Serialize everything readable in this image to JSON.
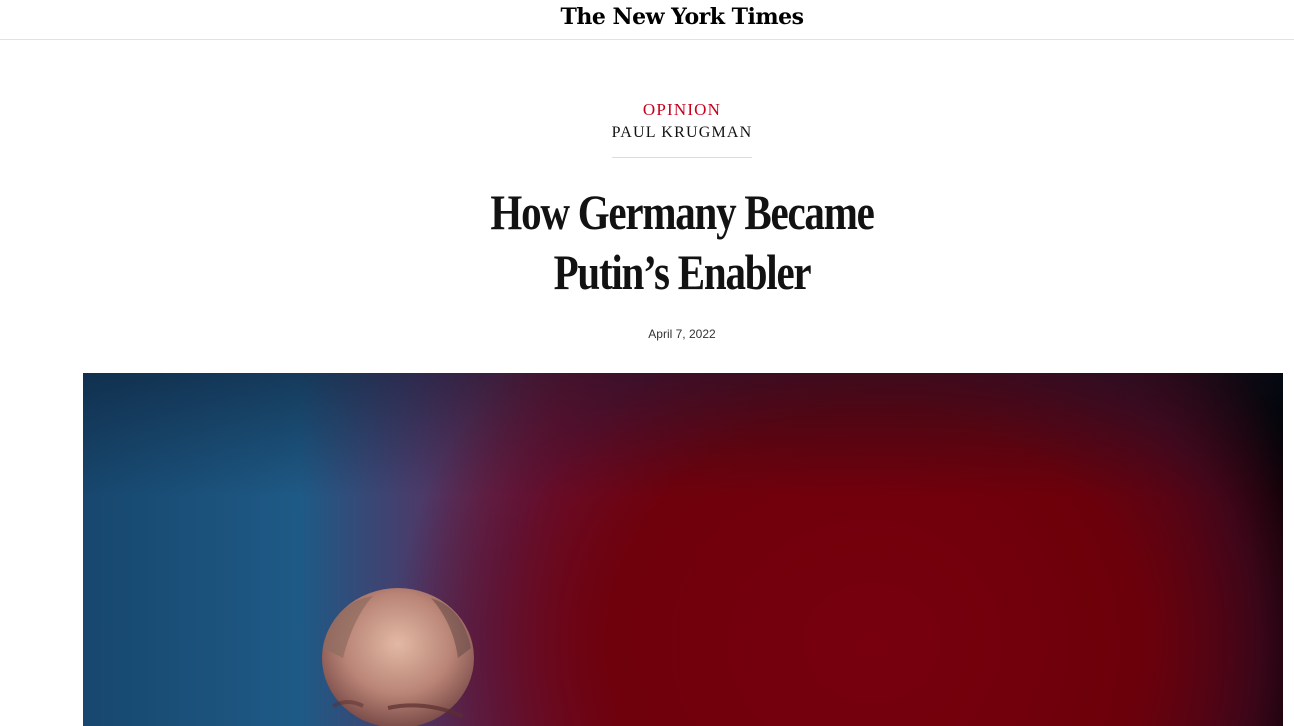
{
  "masthead": {
    "logo_text": "The New York Times"
  },
  "article": {
    "kicker": "OPINION",
    "byline": "PAUL KRUGMAN",
    "headline": "How Germany Became Putin’s Enabler",
    "date": "April 7, 2022"
  },
  "colors": {
    "kicker": "#c8001e",
    "text": "#121212",
    "rule": "#e2e2e2"
  },
  "hero_image": {
    "icon": "photo-of-man-against-red-and-blue-light"
  }
}
